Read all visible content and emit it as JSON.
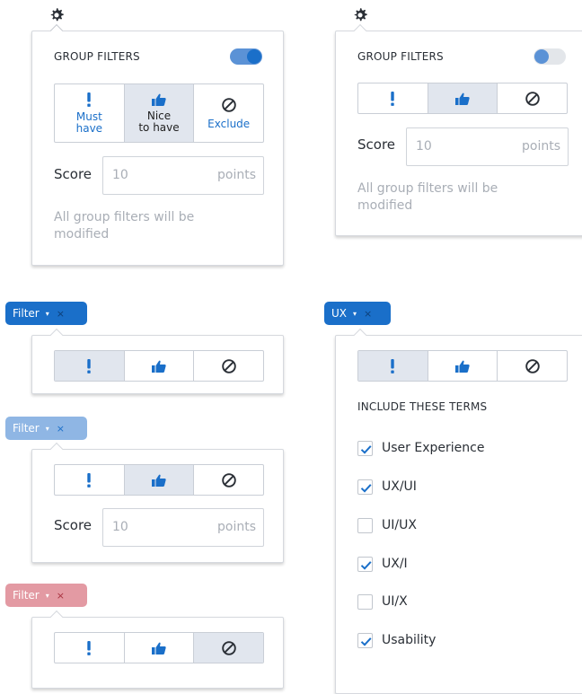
{
  "colors": {
    "accent": "#1a6fc9",
    "toggle_on": "#5b92d6",
    "toggle_off": "#c8ccd2",
    "tag_blue": "#1a6fc9",
    "tag_lightblue": "#8fb6e4",
    "tag_pink": "#e39aa3",
    "selected_bg": "#e1e6ee",
    "muted_text": "#a9aeb6"
  },
  "group_filters_expanded": {
    "title": "GROUP FILTERS",
    "toggle_on": true,
    "options": [
      {
        "icon": "exclamation-icon",
        "label_line1": "Must",
        "label_line2": "have",
        "selected": false
      },
      {
        "icon": "thumbs-up-icon",
        "label_line1": "Nice",
        "label_line2": "to have",
        "selected": true
      },
      {
        "icon": "ban-icon",
        "label_line1": "Exclude",
        "label_line2": "",
        "selected": false
      }
    ],
    "score_label": "Score",
    "score_value": "10",
    "score_unit": "points",
    "note_line1": "All group filters will be",
    "note_line2": "modified"
  },
  "group_filters_compact": {
    "title": "GROUP FILTERS",
    "toggle_on": false,
    "score_label": "Score",
    "score_value": "10",
    "score_unit": "points",
    "note_line1": "All group filters will be",
    "note_line2": "modified"
  },
  "filter_must": {
    "tag_label": "Filter",
    "caret": "▾",
    "close": "×"
  },
  "filter_nice": {
    "tag_label": "Filter",
    "caret": "▾",
    "close": "×",
    "score_label": "Score",
    "score_value": "10",
    "score_unit": "points"
  },
  "filter_exclude": {
    "tag_label": "Filter",
    "caret": "▾",
    "close": "×"
  },
  "ux_filter": {
    "tag_label": "UX",
    "caret": "▾",
    "close": "×",
    "section_title": "INCLUDE THESE TERMS",
    "terms": [
      {
        "label": "User Experience",
        "checked": true
      },
      {
        "label": "UX/UI",
        "checked": true
      },
      {
        "label": "UI/UX",
        "checked": false
      },
      {
        "label": "UX/I",
        "checked": true
      },
      {
        "label": "UI/X",
        "checked": false
      },
      {
        "label": "Usability",
        "checked": true
      }
    ]
  }
}
